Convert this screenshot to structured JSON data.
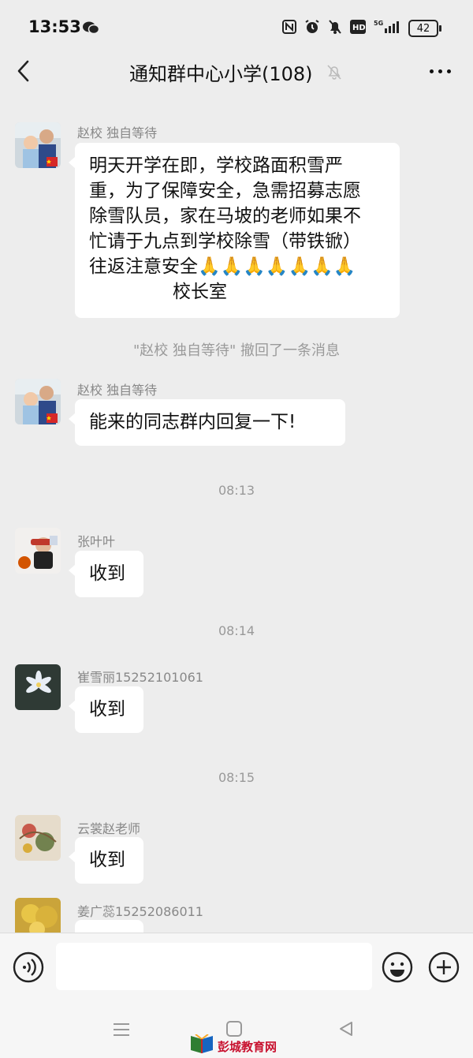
{
  "status_bar": {
    "time": "13:53",
    "network": "5G",
    "battery": "42"
  },
  "header": {
    "title": "通知群中心小学(108)"
  },
  "messages": [
    {
      "sender": "赵校  独自等待",
      "text_lines": [
        "明天开学在即，学校路面积雪严",
        "重，为了保障安全，急需招募志愿",
        "除雪队员，家在马坡的老师如果不",
        "忙请于九点到学校除雪（带铁锨）",
        "往返注意安全🙏🙏🙏🙏🙏🙏🙏",
        "校长室"
      ]
    },
    {
      "sender": "赵校  独自等待",
      "text": "能来的同志群内回复一下!"
    },
    {
      "sender": "张叶叶",
      "text": "收到"
    },
    {
      "sender": "崔雪丽15252101061",
      "text": "收到"
    },
    {
      "sender": "云裳赵老师",
      "text": "收到"
    },
    {
      "sender": "姜广蕊15252086011",
      "text": ""
    }
  ],
  "recall_notice": "\"赵校  独自等待\" 撤回了一条消息",
  "timestamps": [
    "08:13",
    "08:14",
    "08:15"
  ],
  "input_bar": {
    "value": ""
  },
  "watermark": "彭城教育网",
  "colors": {
    "background": "#ededed",
    "bubble": "#ffffff",
    "meta_text": "#999999"
  }
}
